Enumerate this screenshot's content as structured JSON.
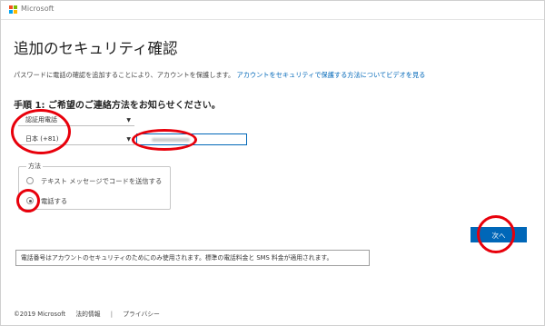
{
  "header": {
    "brand": "Microsoft",
    "logo_colors": [
      "#f25022",
      "#7fba00",
      "#00a4ef",
      "#ffb900"
    ]
  },
  "page": {
    "title": "追加のセキュリティ確認",
    "description": "パスワードに電話の確認を追加することにより、アカウントを保護します。",
    "video_link": "アカウントをセキュリティで保護する方法についてビデオを見る"
  },
  "step": {
    "label": "手順 1: ご希望のご連絡方法をお知らせください。"
  },
  "form": {
    "contact_type": "認証用電話",
    "country": "日本 (+81)",
    "phone_value": ""
  },
  "method": {
    "legend": "方法",
    "options": [
      {
        "label": "テキスト メッセージでコードを送信する",
        "selected": false
      },
      {
        "label": "電話する",
        "selected": true
      }
    ]
  },
  "actions": {
    "next": "次へ"
  },
  "notice": "電話番号はアカウントのセキュリティのためにのみ使用されます。標準の電話料金と SMS 料金が適用されます。",
  "footer": {
    "copyright": "©2019 Microsoft",
    "legal": "法的情報",
    "separator": "|",
    "privacy": "プライバシー"
  },
  "annotation_color": "#e8000b"
}
